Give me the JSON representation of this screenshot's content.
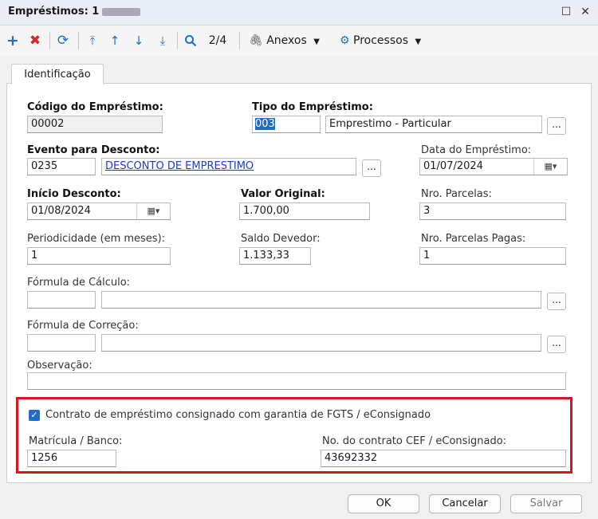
{
  "window": {
    "title": "Empréstimos: 1 -",
    "minimize_icon": "minimize-icon",
    "close_icon": "close-icon"
  },
  "toolbar": {
    "record_position": "2/4",
    "attachments_label": "Anexos",
    "processes_label": "Processos"
  },
  "tabs": [
    {
      "label": "Identificação",
      "active": true
    }
  ],
  "form": {
    "codigo_label": "Código do Empréstimo:",
    "codigo_value": "00002",
    "tipo_label": "Tipo do Empréstimo:",
    "tipo_code": "003",
    "tipo_desc": "Emprestimo - Particular",
    "evento_label": "Evento para Desconto:",
    "evento_code": "0235",
    "evento_desc": "DESCONTO DE EMPRESTIMO",
    "data_emprestimo_label": "Data do Empréstimo:",
    "data_emprestimo_value": "01/07/2024",
    "inicio_label": "Início Desconto:",
    "inicio_value": "01/08/2024",
    "valor_label": "Valor Original:",
    "valor_value": "1.700,00",
    "nro_parcelas_label": "Nro. Parcelas:",
    "nro_parcelas_value": "3",
    "periodicidade_label": "Periodicidade (em meses):",
    "periodicidade_value": "1",
    "saldo_label": "Saldo Devedor:",
    "saldo_value": "1.133,33",
    "parcelas_pagas_label": "Nro. Parcelas Pagas:",
    "parcelas_pagas_value": "1",
    "formula_calculo_label": "Fórmula de Cálculo:",
    "formula_correcao_label": "Fórmula de Correção:",
    "observacao_label": "Observação:",
    "lookup_label": "...",
    "fgts_checkbox_label": "Contrato de empréstimo consignado com garantia de FGTS / eConsignado",
    "fgts_checked": true,
    "matricula_label": "Matrícula / Banco:",
    "matricula_value": "1256",
    "contrato_label": "No. do contrato CEF / eConsignado:",
    "contrato_value": "43692332"
  },
  "buttons": {
    "ok": "OK",
    "cancel": "Cancelar",
    "save": "Salvar"
  },
  "colors": {
    "accent": "#1e6fc4",
    "delete": "#d12b2b",
    "highlight_box": "#d9141c",
    "link": "#1a3dcc"
  }
}
